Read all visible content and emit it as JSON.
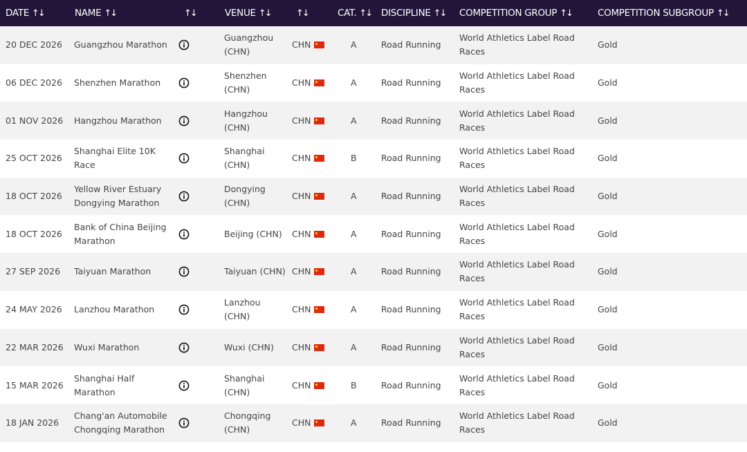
{
  "header": {
    "date": "DATE",
    "name": "NAME",
    "venue": "VENUE",
    "cat": "CAT.",
    "discipline": "DISCIPLINE",
    "group": "COMPETITION GROUP",
    "subgroup": "COMPETITION SUBGROUP"
  },
  "colors": {
    "header_bg": "#21163a",
    "row_alt": "#f2f2f2",
    "flag_red": "#de2910",
    "flag_star": "#ffde00"
  },
  "rows": [
    {
      "date": "20 DEC 2026",
      "name": "Guangzhou Marathon",
      "venue": "Guangzhou (CHN)",
      "country": "CHN",
      "cat": "A",
      "discipline": "Road Running",
      "group": "World Athletics Label Road Races",
      "subgroup": "Gold"
    },
    {
      "date": "06 DEC 2026",
      "name": "Shenzhen Marathon",
      "venue": "Shenzhen (CHN)",
      "country": "CHN",
      "cat": "A",
      "discipline": "Road Running",
      "group": "World Athletics Label Road Races",
      "subgroup": "Gold"
    },
    {
      "date": "01 NOV 2026",
      "name": "Hangzhou Marathon",
      "venue": "Hangzhou (CHN)",
      "country": "CHN",
      "cat": "A",
      "discipline": "Road Running",
      "group": "World Athletics Label Road Races",
      "subgroup": "Gold"
    },
    {
      "date": "25 OCT 2026",
      "name": "Shanghai Elite 10K Race",
      "venue": "Shanghai (CHN)",
      "country": "CHN",
      "cat": "B",
      "discipline": "Road Running",
      "group": "World Athletics Label Road Races",
      "subgroup": "Gold"
    },
    {
      "date": "18 OCT 2026",
      "name": "Yellow River Estuary Dongying Marathon",
      "venue": "Dongying (CHN)",
      "country": "CHN",
      "cat": "A",
      "discipline": "Road Running",
      "group": "World Athletics Label Road Races",
      "subgroup": "Gold"
    },
    {
      "date": "18 OCT 2026",
      "name": "Bank of China Beijing Marathon",
      "venue": "Beijing (CHN)",
      "country": "CHN",
      "cat": "A",
      "discipline": "Road Running",
      "group": "World Athletics Label Road Races",
      "subgroup": "Gold"
    },
    {
      "date": "27 SEP 2026",
      "name": "Taiyuan Marathon",
      "venue": "Taiyuan (CHN)",
      "country": "CHN",
      "cat": "A",
      "discipline": "Road Running",
      "group": "World Athletics Label Road Races",
      "subgroup": "Gold"
    },
    {
      "date": "24 MAY 2026",
      "name": "Lanzhou Marathon",
      "venue": "Lanzhou (CHN)",
      "country": "CHN",
      "cat": "A",
      "discipline": "Road Running",
      "group": "World Athletics Label Road Races",
      "subgroup": "Gold"
    },
    {
      "date": "22 MAR 2026",
      "name": "Wuxi Marathon",
      "venue": "Wuxi (CHN)",
      "country": "CHN",
      "cat": "A",
      "discipline": "Road Running",
      "group": "World Athletics Label Road Races",
      "subgroup": "Gold"
    },
    {
      "date": "15 MAR 2026",
      "name": "Shanghai Half Marathon",
      "venue": "Shanghai (CHN)",
      "country": "CHN",
      "cat": "B",
      "discipline": "Road Running",
      "group": "World Athletics Label Road Races",
      "subgroup": "Gold"
    },
    {
      "date": "18 JAN 2026",
      "name": "Chang'an Automobile Chongqing Marathon",
      "venue": "Chongqing (CHN)",
      "country": "CHN",
      "cat": "A",
      "discipline": "Road Running",
      "group": "World Athletics Label Road Races",
      "subgroup": "Gold"
    }
  ]
}
